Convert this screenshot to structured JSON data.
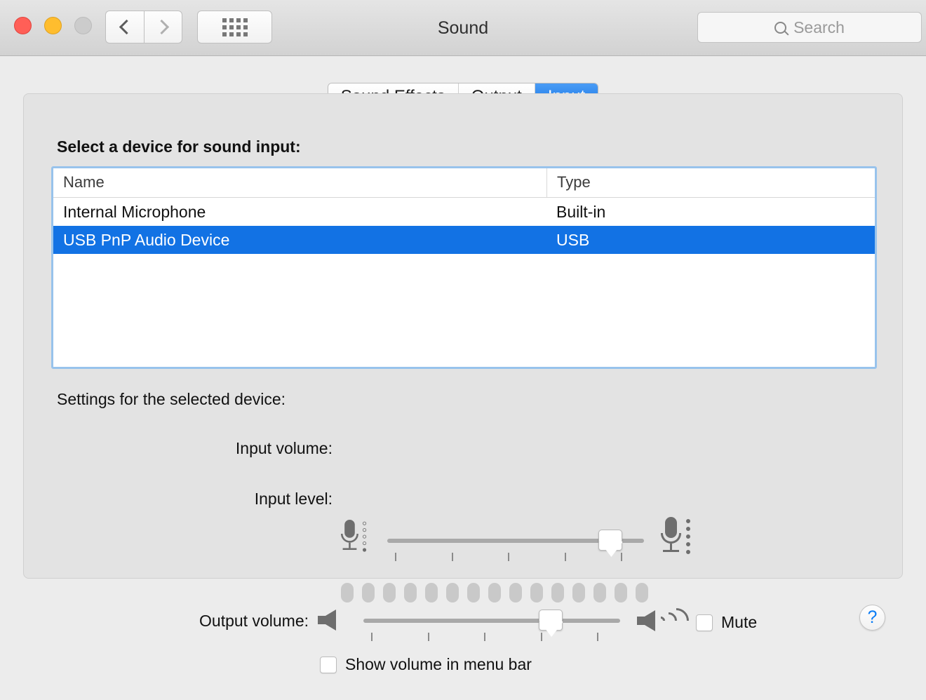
{
  "window": {
    "title": "Sound",
    "traffic_lights": [
      "close",
      "minimize",
      "maximize"
    ],
    "nav_back": "‹",
    "nav_forward": "›",
    "grid_button": "show-all-icon",
    "search": {
      "placeholder": "Search",
      "value": "",
      "icon": "search-icon"
    }
  },
  "tabs": [
    {
      "label": "Sound Effects",
      "active": false
    },
    {
      "label": "Output",
      "active": false
    },
    {
      "label": "Input",
      "active": true
    }
  ],
  "main": {
    "device_prompt": "Select a device for sound input:",
    "table": {
      "columns": [
        "Name",
        "Type"
      ],
      "rows": [
        {
          "name": "Internal Microphone",
          "type": "Built-in",
          "selected": false
        },
        {
          "name": "USB PnP Audio Device",
          "type": "USB",
          "selected": true
        }
      ]
    },
    "settings_label": "Settings for the selected device:",
    "input_volume": {
      "label": "Input volume:",
      "value_percent": 87,
      "tick_count": 5,
      "left_icon": "microphone-quiet-icon",
      "right_icon": "microphone-loud-icon"
    },
    "input_level": {
      "label": "Input level:",
      "segment_count": 15,
      "active_segments": 0
    },
    "help_button": "?"
  },
  "bottom": {
    "output_volume": {
      "label": "Output volume:",
      "value_percent": 73,
      "tick_count": 5,
      "left_icon": "speaker-quiet-icon",
      "right_icon": "speaker-loud-icon"
    },
    "mute": {
      "label": "Mute",
      "checked": false
    },
    "show_volume_in_menu_bar": {
      "label": "Show volume in menu bar",
      "checked": false
    }
  },
  "colors": {
    "accent_blue": "#1272e4",
    "tab_active_blue": "#1272e4",
    "focus_ring": "#98c3ec",
    "help_blue": "#0a7cf5",
    "window_bg": "#ececec",
    "panel_bg": "#e3e3e3"
  }
}
